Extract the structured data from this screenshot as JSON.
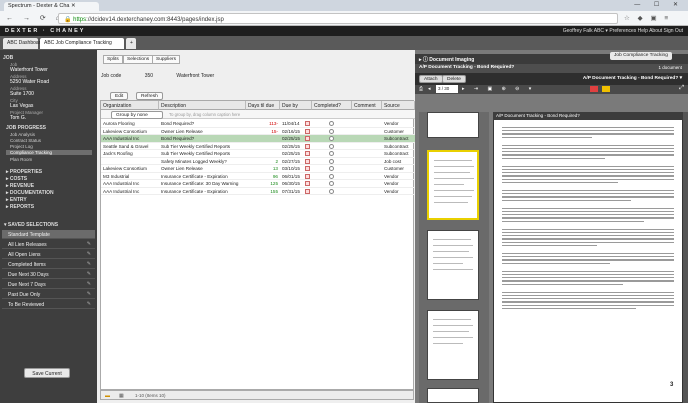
{
  "browser": {
    "tab_title": "Spectrum - Dexter & Cha",
    "url_secure": "https",
    "url_rest": "://dcidev14.dexterchaney.com:8443/pages/index.jsp",
    "window_controls": "— ☐ ✕"
  },
  "app": {
    "logo": "DEXTER · CHANEY",
    "user_nav": "Geoffrey Falk   ABC ▾   Preferences   Help   About   Sign Out"
  },
  "module_tabs": [
    {
      "label": "ABC Dashboard"
    },
    {
      "label": "ABC Job Compliance Tracking"
    },
    {
      "label": "+"
    }
  ],
  "sidebar": {
    "job_section": "JOB",
    "fields": [
      {
        "label": "Job",
        "value": "Waterfront Tower"
      },
      {
        "label": "Address",
        "value": "5250 Water Road"
      },
      {
        "label": "Address",
        "value": "Suite 1700"
      },
      {
        "label": "City",
        "value": "Las Vegas"
      },
      {
        "label": "Project Manager",
        "value": "Tom G."
      }
    ],
    "job_progress": "JOB PROGRESS",
    "progress_items": [
      "Job Analysis",
      "Contract Status",
      "Project Log",
      "Compliance Tracking",
      "Plan Room"
    ],
    "active_item": "Compliance Tracking",
    "groups": [
      "PROPERTIES",
      "COSTS",
      "REVENUE",
      "DOCUMENTATION",
      "ENTRY",
      "REPORTS"
    ],
    "saved_header": "SAVED SELECTIONS",
    "saved": [
      "Standard Template",
      "All Lien Releases",
      "All Open Liens",
      "Completed Items",
      "Due Next 30 Days",
      "Due Next 7 Days",
      "Past Due Only",
      "To Be Reviewed"
    ],
    "save_button": "Save Current"
  },
  "main": {
    "subtabs": [
      "Splits",
      "Selections",
      "Suppliers"
    ],
    "job_code_label": "Job code",
    "job_code": "350",
    "job_name": "Waterfront Tower",
    "edit_button": "Edit",
    "refresh_button": "Refresh",
    "columns": [
      "Organization",
      "Description",
      "Days til due",
      "Due by",
      "Completed?",
      "Comment",
      "Source"
    ],
    "group_by": "Group by none",
    "group_hint": "To group by, drag column caption here",
    "rows": [
      {
        "org": "Aurora Flooring",
        "desc": "Bond Required?",
        "days": "113-",
        "due": "11/04/14",
        "src": "Vendor",
        "color": "#d00000",
        "sel": false
      },
      {
        "org": "Lakeview Consortium",
        "desc": "Owner Lien Release",
        "days": "15-",
        "due": "02/16/15",
        "src": "Customer",
        "color": "#d00000",
        "sel": false
      },
      {
        "org": "AAA Industrial Inc",
        "desc": "Bond Required?",
        "days": "",
        "due": "02/25/15",
        "src": "Subcontract",
        "color": "#222",
        "sel": true
      },
      {
        "org": "Seattle Sand & Gravel",
        "desc": "Sub Tier Weekly Certified Reports",
        "days": "",
        "due": "02/25/15",
        "src": "Subcontract",
        "color": "#222",
        "sel": false
      },
      {
        "org": "Jack's Roofing",
        "desc": "Sub Tier Weekly Certified Reports",
        "days": "",
        "due": "02/25/15",
        "src": "Subcontract",
        "color": "#222",
        "sel": false
      },
      {
        "org": "",
        "desc": "Safety Minutes Logged Weekly?",
        "days": "2",
        "due": "02/27/15",
        "src": "Job cost",
        "color": "#1a8a1a",
        "sel": false
      },
      {
        "org": "Lakeview Consortium",
        "desc": "Owner Lien Release",
        "days": "13",
        "due": "03/10/15",
        "src": "Customer",
        "color": "#1a8a1a",
        "sel": false
      },
      {
        "org": "M3 Industrial",
        "desc": "Insurance Certificate - Expiration",
        "days": "96",
        "due": "06/01/15",
        "src": "Vendor",
        "color": "#1a8a1a",
        "sel": false
      },
      {
        "org": "AAA Industrial Inc",
        "desc": "Insurance Certificate: 30 Day Warning",
        "days": "125",
        "due": "06/30/15",
        "src": "Vendor",
        "color": "#1a8a1a",
        "sel": false
      },
      {
        "org": "AAA Industrial Inc",
        "desc": "Insurance Certificate - Expiration",
        "days": "155",
        "due": "07/31/15",
        "src": "Vendor",
        "color": "#1a8a1a",
        "sel": false
      }
    ],
    "footer": "1-10 (Items 10)"
  },
  "header_right": "Job Compliance Tracking",
  "doc": {
    "section": "Document Imaging",
    "bar1_title": "A/P Document Tracking - Bond Required?",
    "doc_count": "1 document",
    "attach": "Attach",
    "delete": "Delete",
    "bar2_title": "A/P Document Tracking - Bond Required? ▾",
    "page_indicator": "3 / 30",
    "page_title": "A/P Document Tracking - Bond Required?",
    "page_number": "3"
  },
  "colors": {
    "selected_row": "#b9d8b6",
    "header_dark": "#1e1e1e",
    "overdue": "#d00000",
    "ok": "#1a8a1a",
    "thumb_active": "#e9d000"
  }
}
